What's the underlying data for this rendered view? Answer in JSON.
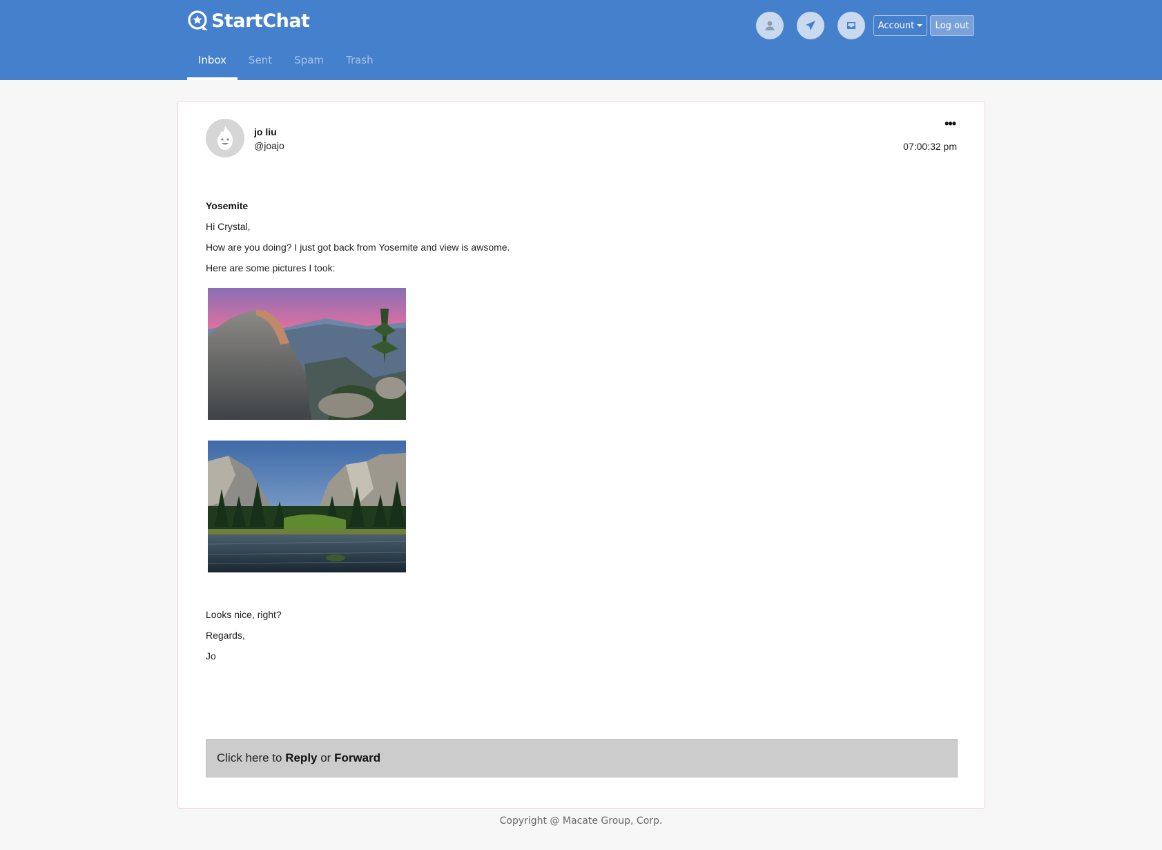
{
  "app": {
    "name": "StartChat",
    "brand_color": "#4580cc"
  },
  "nav": {
    "tabs": [
      {
        "label": "Inbox",
        "active": true
      },
      {
        "label": "Sent",
        "active": false
      },
      {
        "label": "Spam",
        "active": false
      },
      {
        "label": "Trash",
        "active": false
      }
    ]
  },
  "header_actions": {
    "icons": [
      "user-icon",
      "send-icon",
      "inbox-icon"
    ],
    "account_label": "Account",
    "logout_label": "Log out"
  },
  "message": {
    "sender_name": "jo liu",
    "sender_handle": "@joajo",
    "time": "07:00:32 pm",
    "more_label": "•••",
    "subject": "Yosemite",
    "greeting": "Hi Crystal,",
    "body_lines": [
      "How are you doing? I just got back from Yosemite and view is awsome.",
      "Here are some pictures I took:"
    ],
    "closing_lines": [
      "Looks nice, right?",
      "Regards,",
      "Jo"
    ]
  },
  "reply_bar": {
    "prefix": "Click here to ",
    "reply": "Reply",
    "middle": " or ",
    "forward": "Forward"
  },
  "footer": {
    "copyright": "Copyright @ Macate Group, Corp."
  }
}
